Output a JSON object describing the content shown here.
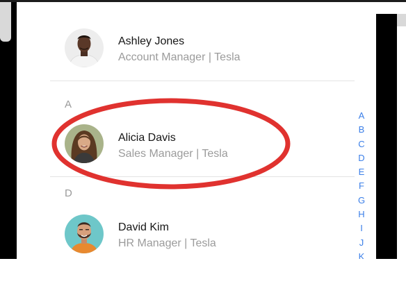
{
  "contacts": [
    {
      "name": "Ashley Jones",
      "subtitle": "Account Manager | Tesla",
      "avatar_icon": "man-portrait-icon"
    },
    {
      "name": "Alicia Davis",
      "subtitle": "Sales Manager | Tesla",
      "avatar_icon": "woman-portrait-icon"
    },
    {
      "name": "David Kim",
      "subtitle": "HR Manager | Tesla",
      "avatar_icon": "bearded-man-portrait-icon"
    }
  ],
  "sections": [
    "A",
    "D"
  ],
  "index_letters": [
    "A",
    "B",
    "C",
    "D",
    "E",
    "F",
    "G",
    "H",
    "I",
    "J",
    "K"
  ],
  "colors": {
    "index_accent": "#3b7fe8",
    "highlight_ring": "#e0322f",
    "name_text": "#161616",
    "subtitle_text": "#9b9b9b"
  }
}
